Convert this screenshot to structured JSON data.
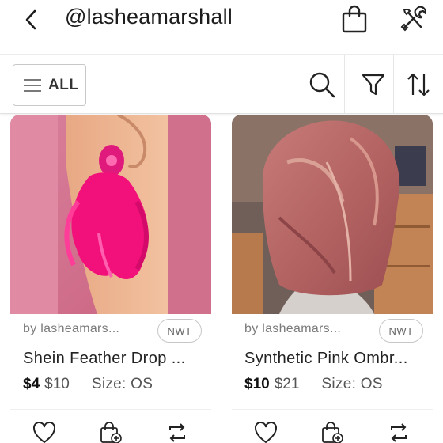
{
  "header": {
    "title": "@lasheamarshall",
    "icons": [
      "back-chevron-icon",
      "shopping-bag-icon",
      "tools-icon"
    ]
  },
  "filterbar": {
    "all_label": "ALL",
    "icons": [
      "hamburger-icon",
      "search-icon",
      "filter-icon",
      "sort-icon"
    ]
  },
  "listings": [
    {
      "seller": "by lasheamars...",
      "badge": "NWT",
      "title": "Shein Feather Drop ...",
      "price": "$4",
      "original_price": "$10",
      "size": "Size: OS",
      "image_desc_colors": [
        "#d97894",
        "#f2136f",
        "#e8a07f"
      ]
    },
    {
      "seller": "by lasheamars...",
      "badge": "NWT",
      "title": "Synthetic Pink Ombr...",
      "price": "$10",
      "original_price": "$21",
      "size": "Size: OS",
      "image_desc_colors": [
        "#b8696c",
        "#7e4a3c",
        "#cf8f7e"
      ]
    }
  ],
  "colors": {
    "text_dark": "#222222",
    "text_muted": "#7a7a7a",
    "border": "#c8c8c8"
  }
}
